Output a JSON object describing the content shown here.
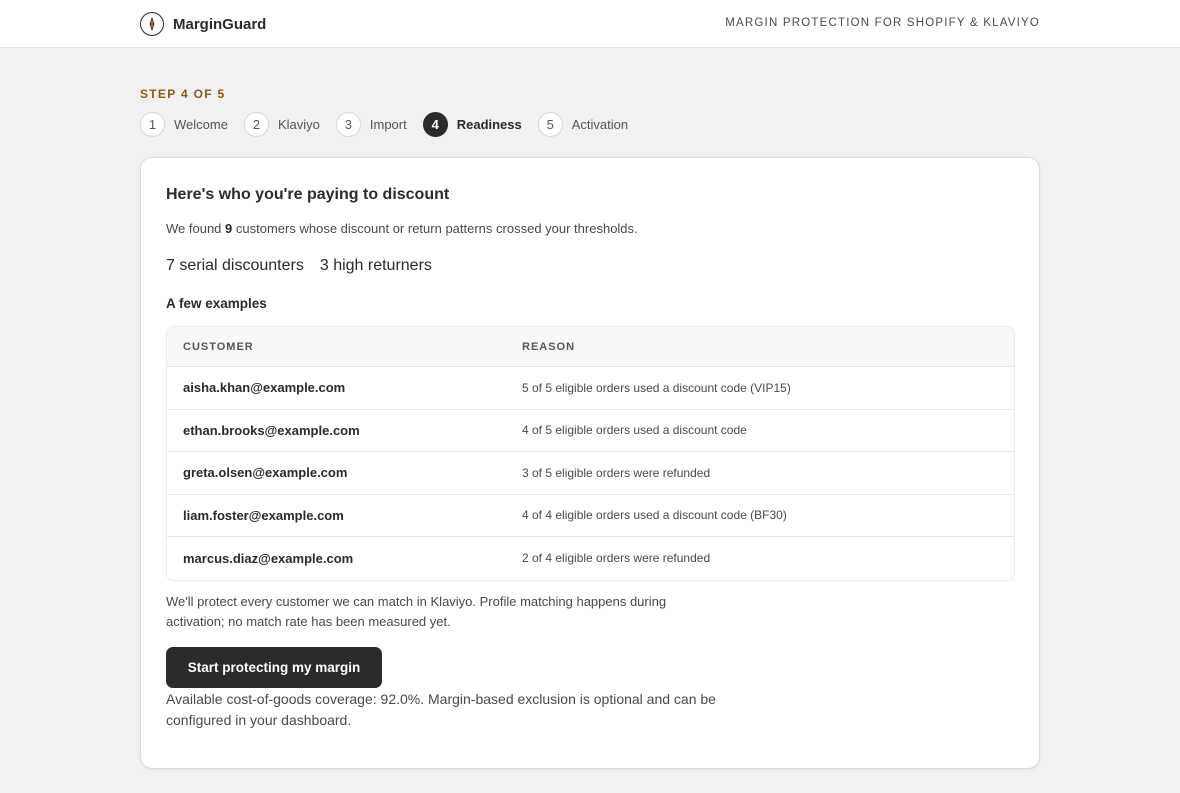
{
  "header": {
    "brand": "MarginGuard",
    "logo_icon": "compass-icon",
    "tagline": "MARGIN PROTECTION FOR SHOPIFY & KLAVIYO"
  },
  "progress": {
    "label": "STEP 4 OF 5",
    "steps": [
      {
        "number": "1",
        "label": "Welcome",
        "active": false
      },
      {
        "number": "2",
        "label": "Klaviyo",
        "active": false
      },
      {
        "number": "3",
        "label": "Import",
        "active": false
      },
      {
        "number": "4",
        "label": "Readiness",
        "active": true
      },
      {
        "number": "5",
        "label": "Activation",
        "active": false
      }
    ]
  },
  "card": {
    "title": "Here's who you're paying to discount",
    "desc_prefix": "We found",
    "desc_count": "9",
    "desc_suffix": "customers whose discount or return patterns crossed your thresholds.",
    "stats": {
      "serial_discounters": "7 serial discounters",
      "high_returners": "3 high returners"
    },
    "examples_title": "A few examples",
    "table": {
      "headers": [
        "CUSTOMER",
        "REASON"
      ],
      "rows": [
        {
          "customer": "aisha.khan@example.com",
          "reason": "5 of 5 eligible orders used a discount code (VIP15)"
        },
        {
          "customer": "ethan.brooks@example.com",
          "reason": "4 of 5 eligible orders used a discount code"
        },
        {
          "customer": "greta.olsen@example.com",
          "reason": "3 of 5 eligible orders were refunded"
        },
        {
          "customer": "liam.foster@example.com",
          "reason": "4 of 4 eligible orders used a discount code (BF30)"
        },
        {
          "customer": "marcus.diaz@example.com",
          "reason": "2 of 4 eligible orders were refunded"
        }
      ]
    },
    "note": "We'll protect every customer we can match in Klaviyo. Profile matching happens during activation; no match rate has been measured yet.",
    "cta_label": "Start protecting my margin",
    "coverage": "Available cost-of-goods coverage: 92.0%. Margin-based exclusion is optional and can be configured in your dashboard."
  },
  "colors": {
    "accent_step_label": "#8a5a10",
    "primary_dark": "#2b2b2b",
    "background": "#f1f1f1"
  }
}
